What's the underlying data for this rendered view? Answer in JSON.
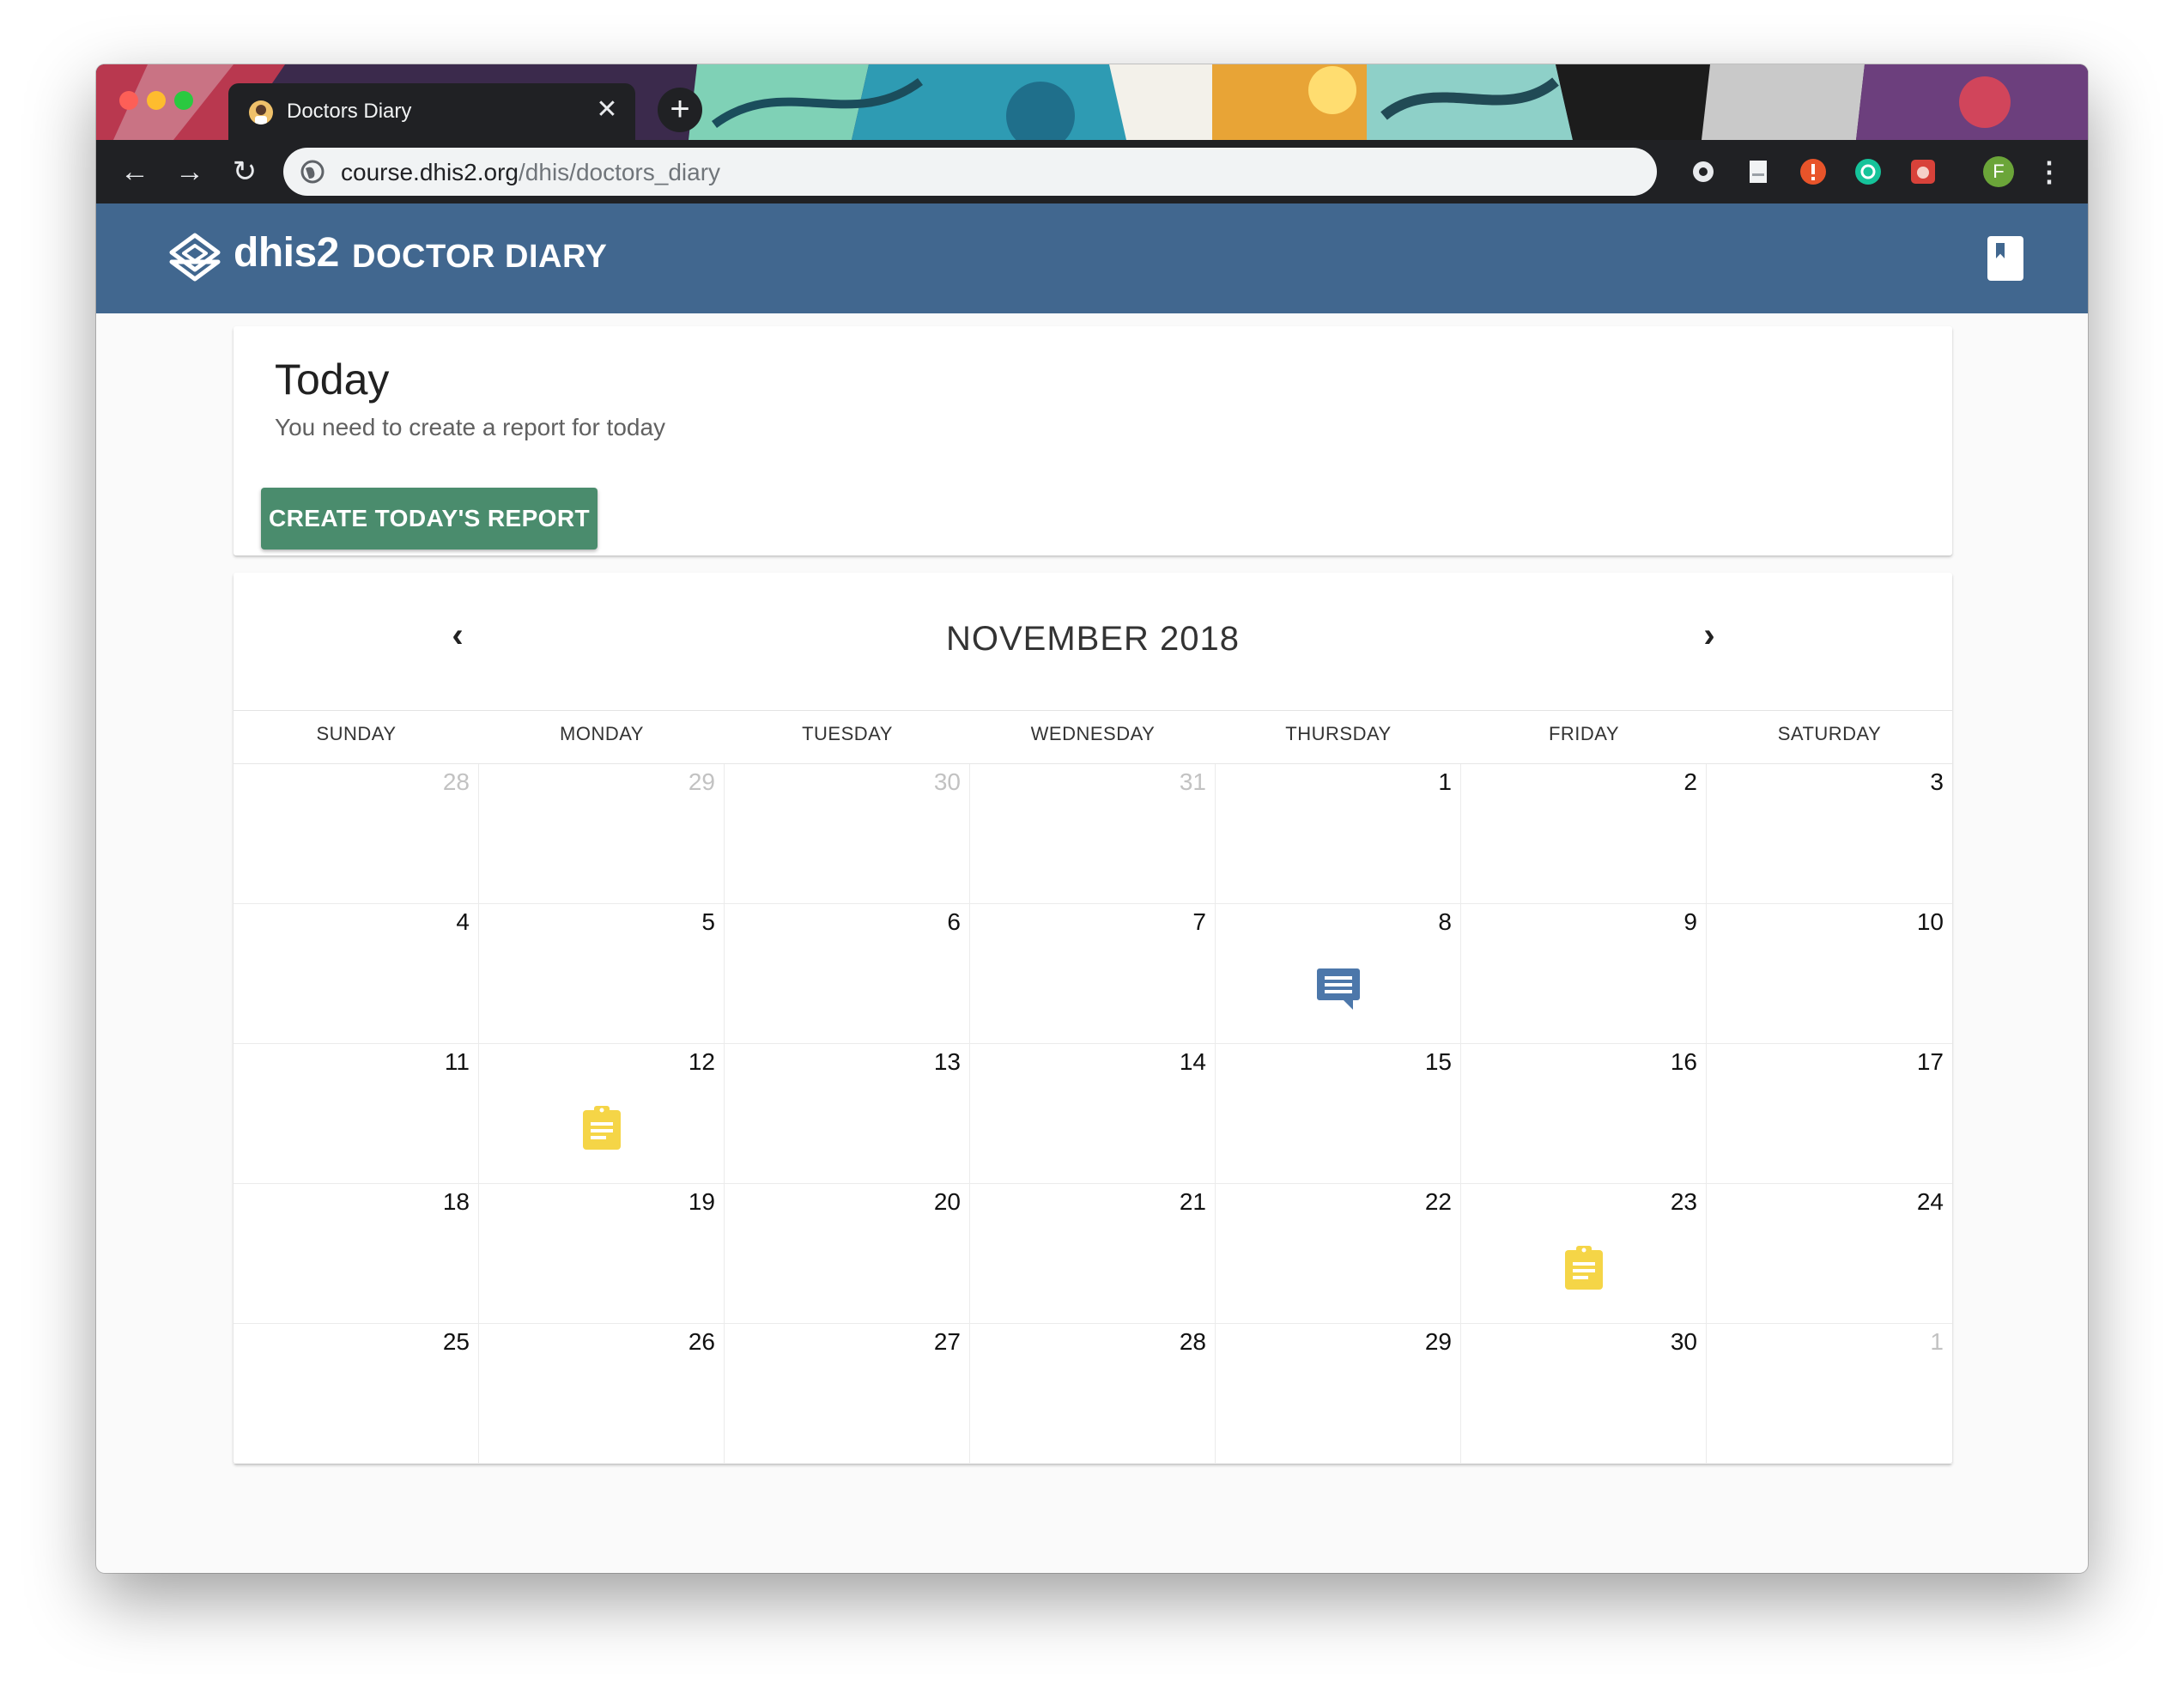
{
  "browser": {
    "tab_title": "Doctors Diary",
    "tab_close": "✕",
    "new_tab": "+",
    "url_domain": "course.dhis2.org",
    "url_path": "/dhis/doctors_diary",
    "profile_initial": "F",
    "nav": {
      "back": "←",
      "forward": "→",
      "reload": "↻",
      "menu": "⋮"
    }
  },
  "header": {
    "brand": "dhis2",
    "title": "DOCTOR DIARY"
  },
  "today": {
    "title": "Today",
    "subtitle": "You need to create a report for today",
    "button": "CREATE TODAY'S REPORT"
  },
  "calendar": {
    "month_label": "NOVEMBER 2018",
    "prev": "‹",
    "next": "›",
    "weekdays": [
      "SUNDAY",
      "MONDAY",
      "TUESDAY",
      "WEDNESDAY",
      "THURSDAY",
      "FRIDAY",
      "SATURDAY"
    ],
    "days": [
      {
        "n": "28",
        "other": true
      },
      {
        "n": "29",
        "other": true
      },
      {
        "n": "30",
        "other": true
      },
      {
        "n": "31",
        "other": true
      },
      {
        "n": "1"
      },
      {
        "n": "2"
      },
      {
        "n": "3"
      },
      {
        "n": "4"
      },
      {
        "n": "5"
      },
      {
        "n": "6"
      },
      {
        "n": "7"
      },
      {
        "n": "8",
        "icon": "comment-icon"
      },
      {
        "n": "9"
      },
      {
        "n": "10"
      },
      {
        "n": "11"
      },
      {
        "n": "12",
        "icon": "report-icon"
      },
      {
        "n": "13"
      },
      {
        "n": "14"
      },
      {
        "n": "15"
      },
      {
        "n": "16"
      },
      {
        "n": "17"
      },
      {
        "n": "18"
      },
      {
        "n": "19"
      },
      {
        "n": "20"
      },
      {
        "n": "21"
      },
      {
        "n": "22"
      },
      {
        "n": "23",
        "icon": "report-icon"
      },
      {
        "n": "24"
      },
      {
        "n": "25"
      },
      {
        "n": "26"
      },
      {
        "n": "27"
      },
      {
        "n": "28"
      },
      {
        "n": "29"
      },
      {
        "n": "30"
      },
      {
        "n": "1",
        "other": true
      }
    ]
  },
  "colors": {
    "header_bg": "#41678f",
    "button_bg": "#4a8c6d",
    "comment_icon": "#4c77aa",
    "report_icon": "#f5d547"
  }
}
